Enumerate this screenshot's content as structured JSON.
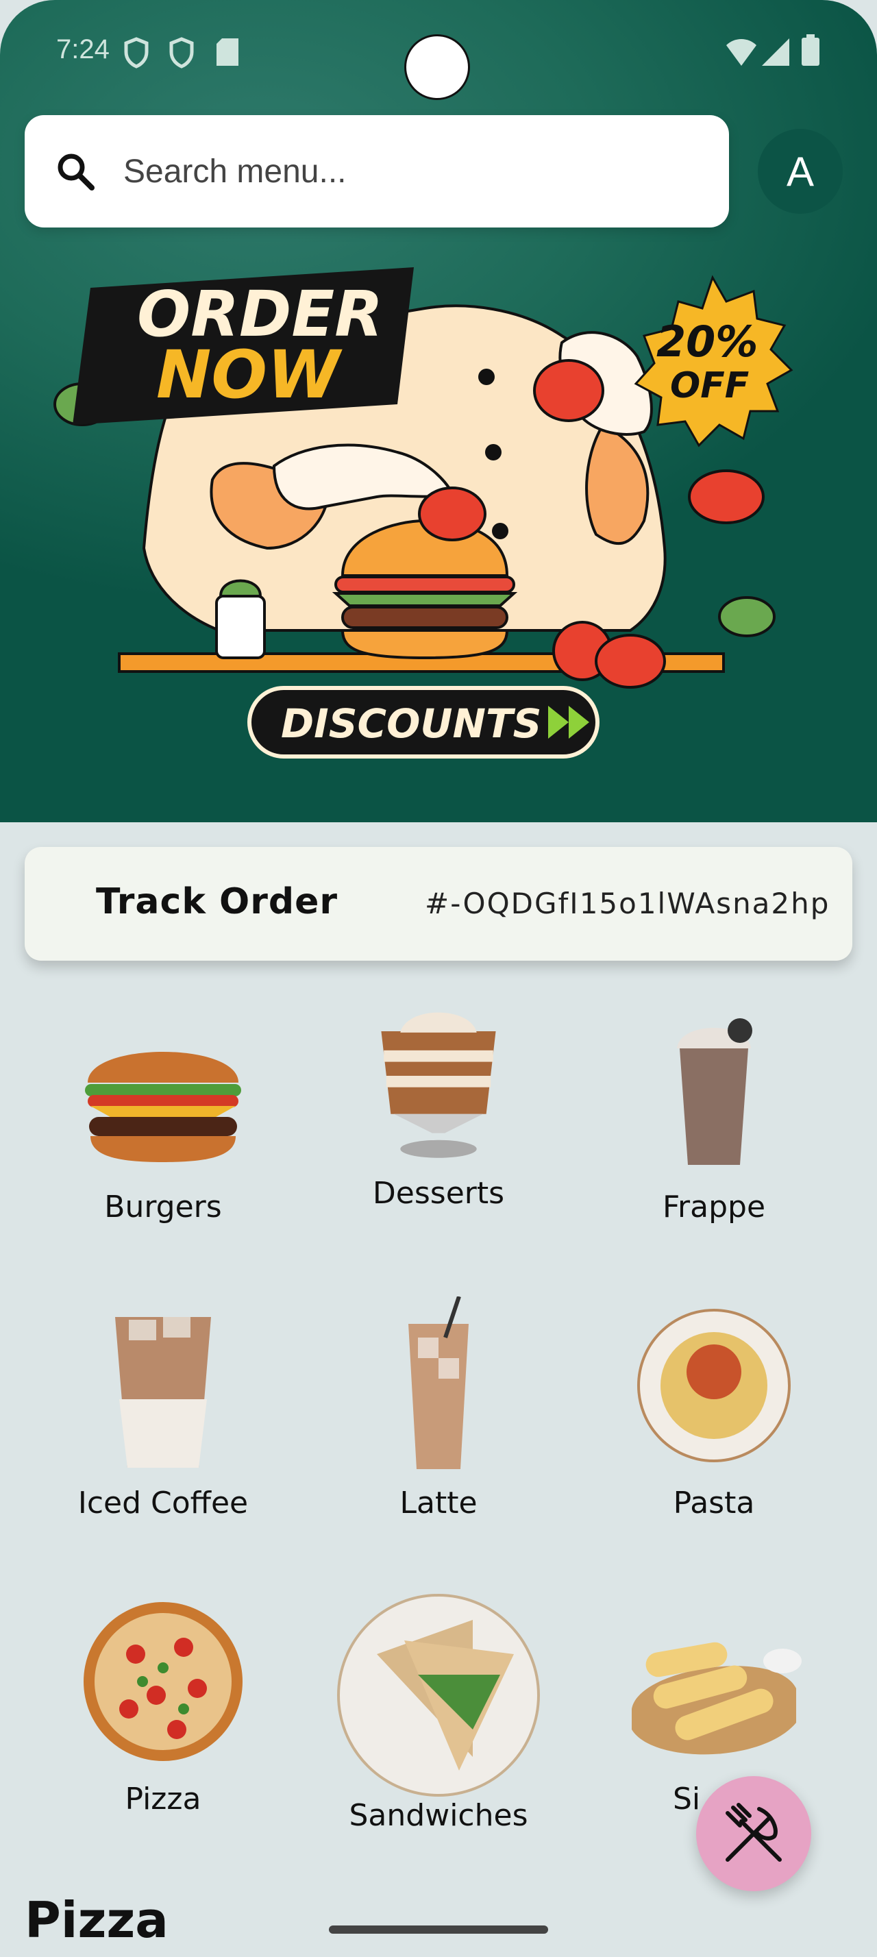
{
  "status": {
    "time": "7:24"
  },
  "search": {
    "placeholder": "Search menu..."
  },
  "avatar": {
    "initial": "A"
  },
  "banner": {
    "order": "ORDER",
    "now": "NOW",
    "discount_pct": "20%",
    "off": "OFF",
    "discounts": "DISCOUNTS"
  },
  "track": {
    "label": "Track Order",
    "code": "#-OQDGfI15o1lWAsna2hp"
  },
  "categories": [
    {
      "label": "Burgers"
    },
    {
      "label": "Desserts"
    },
    {
      "label": "Frappe"
    },
    {
      "label": "Iced Coffee"
    },
    {
      "label": "Latte"
    },
    {
      "label": "Pasta"
    },
    {
      "label": "Pizza"
    },
    {
      "label": "Sandwiches"
    },
    {
      "label": "Si"
    }
  ],
  "section": {
    "title": "Pizza"
  },
  "colors": {
    "accent": "#0b5445",
    "fab": "#e6a3c4",
    "card": "#f2f5ef"
  }
}
